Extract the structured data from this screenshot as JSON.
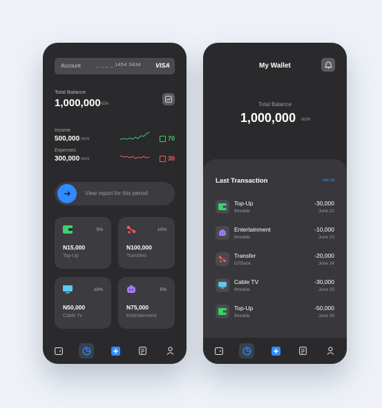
{
  "left": {
    "account_label": "Account",
    "account_number": "_ _ _ _ 1454 3434",
    "card_brand": "VISA",
    "total_balance_label": "Total Balance",
    "total_balance_value": "1,000,000",
    "currency": "NGN",
    "income_label": "Income",
    "income_value": "500,000",
    "income_change": "70",
    "expenses_label": "Expenses",
    "expenses_value": "300,000",
    "expenses_change": "30",
    "report_text": "View report for this period",
    "tiles": [
      {
        "percent": "5%",
        "value": "N15,000",
        "name": "Top-Up",
        "icon": "wallet-icon",
        "color": "#39d36b"
      },
      {
        "percent": "10%",
        "value": "N100,000",
        "name": "Transfers",
        "icon": "transfer-icon",
        "color": "#ff5a5a"
      },
      {
        "percent": "10%",
        "value": "N50,000",
        "name": "Cable Tv",
        "icon": "tv-icon",
        "color": "#5ec8f2"
      },
      {
        "percent": "5%",
        "value": "N75,000",
        "name": "Entertainment",
        "icon": "game-icon",
        "color": "#a47cff"
      }
    ]
  },
  "right": {
    "title": "My Wallet",
    "total_balance_label": "Total Balance",
    "total_balance_value": "1,000,000",
    "currency": "NGN",
    "section_title": "Last Transaction",
    "see_all": "see all",
    "transactions": [
      {
        "name": "Top-Up",
        "source": "9mobile",
        "amount": "-30,000",
        "date": "June 22",
        "icon": "wallet-icon",
        "color": "#39d36b"
      },
      {
        "name": "Entertainment",
        "source": "9mobile",
        "amount": "-10,000",
        "date": "June 23",
        "icon": "game-icon",
        "color": "#a47cff"
      },
      {
        "name": "Transfer",
        "source": "GTBank",
        "amount": "-20,000",
        "date": "June 24",
        "icon": "transfer-icon",
        "color": "#ff5a5a"
      },
      {
        "name": "Cable TV",
        "source": "9mobile",
        "amount": "-30,000",
        "date": "June 25",
        "icon": "tv-icon",
        "color": "#5ec8f2"
      },
      {
        "name": "Top-Up",
        "source": "9mobile",
        "amount": "-50,000",
        "date": "June 26",
        "icon": "wallet-icon",
        "color": "#39d36b"
      }
    ]
  },
  "colors": {
    "accent": "#2f8bff",
    "positive": "#39d36b",
    "negative": "#ff5a5a",
    "panel": "#2a2a2d"
  }
}
